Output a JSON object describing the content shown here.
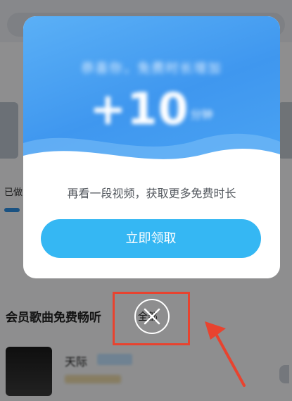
{
  "background": {
    "left_status_text": "已做",
    "section_title": "会员歌曲免费畅听",
    "more_link": "全部",
    "song": {
      "title": "天际"
    }
  },
  "popup": {
    "hero_subtitle": "恭喜你，免费时长增加",
    "hero_amount": "+10",
    "hero_unit": "分钟",
    "description": "再看一段视频，获取更多免费时长",
    "claim_button": "立即领取"
  },
  "colors": {
    "hero_blue": "#4aa3f3",
    "button_blue": "#35b7f3",
    "annotation_red": "#e8432f"
  },
  "icons": {
    "close": "close-icon",
    "arrow": "annotation-arrow-icon"
  }
}
